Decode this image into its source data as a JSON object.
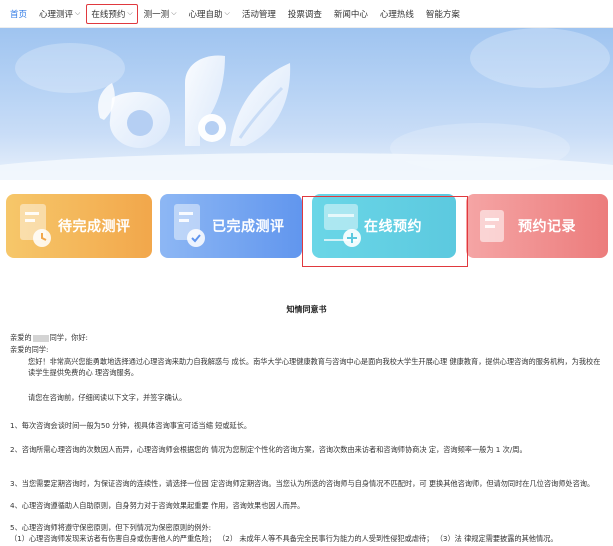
{
  "nav": {
    "items": [
      {
        "label": "首页"
      },
      {
        "label": "心理测评"
      },
      {
        "label": "在线预约"
      },
      {
        "label": "测一测"
      },
      {
        "label": "心理自助"
      },
      {
        "label": "活动管理"
      },
      {
        "label": "投票调查"
      },
      {
        "label": "新闻中心"
      },
      {
        "label": "心理热线"
      },
      {
        "label": "智能方案"
      }
    ]
  },
  "cards": [
    {
      "label": "待完成测评"
    },
    {
      "label": "已完成测评"
    },
    {
      "label": "在线预约"
    },
    {
      "label": "预约记录"
    }
  ],
  "colors": {
    "accent": "#2f7ae5",
    "highlight": "#e0393e"
  },
  "document": {
    "title": "知情同意书",
    "greeting_prefix": "亲爱的",
    "greeting_suffix": "同学，你好:",
    "greeting2": "亲爱的同学:",
    "intro": "您好！非常高兴您能勇敢地选择通过心理咨询来助力自我解惑与 成长。南华大学心理健康教育与咨询中心是面向我校大学生开展心理 健康教育，提供心理咨询的服务机构，为我校在读学生提供免费的心 理咨询服务。",
    "instruction": "请您在咨询前，仔细阅读以下文字，并签字确认。",
    "items": [
      "1、每次咨询会谈时间一般为50 分钟，视具体咨询事宜可适当缩 短或延长。",
      "2、咨询所需心理咨询的次数因人而异，心理咨询师会根据您的 情况为您制定个性化的咨询方案，咨询次数由来访者和咨询师协商决 定，咨询频率一般为 1 次/周。",
      "3、当您需要定期咨询时，为保证咨询的连续性，请选择一位固 定咨询师定期咨询。当您认为所选的咨询师与自身情况不匹配时，可 更换其他咨询师，但请勿同时在几位咨询师处咨询。",
      "4、心理咨询遵循助人自助原则，自身努力对于咨询效果起重要 作用，咨询效果也因人而异。",
      "5、心理咨询师将遵守保密原则，但下列情况为保密原则的例外:",
      "（1）心理咨询师发现来访者有伤害自身或伤害他人的严重危险； （2） 未成年人等不具备完全民事行为能力的人受到性侵犯或虐待； （3）法 律规定需要披露的其他情况。"
    ]
  }
}
